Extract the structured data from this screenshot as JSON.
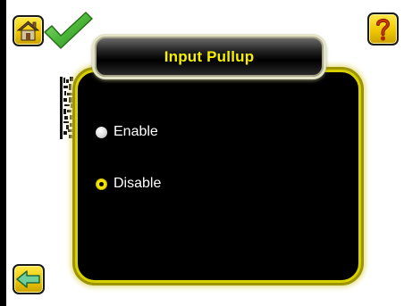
{
  "dialog": {
    "title": "Input Pullup",
    "options": [
      {
        "label": "Enable",
        "selected": false
      },
      {
        "label": "Disable",
        "selected": true
      }
    ]
  },
  "toolbar": {
    "home_icon": "home-icon",
    "status_icon": "checkmark-icon",
    "help_icon": "help-icon",
    "back_icon": "back-arrow-icon"
  },
  "colors": {
    "accent_yellow": "#f7ef00",
    "status_green": "#48b030",
    "dialog_background": "#000000"
  }
}
